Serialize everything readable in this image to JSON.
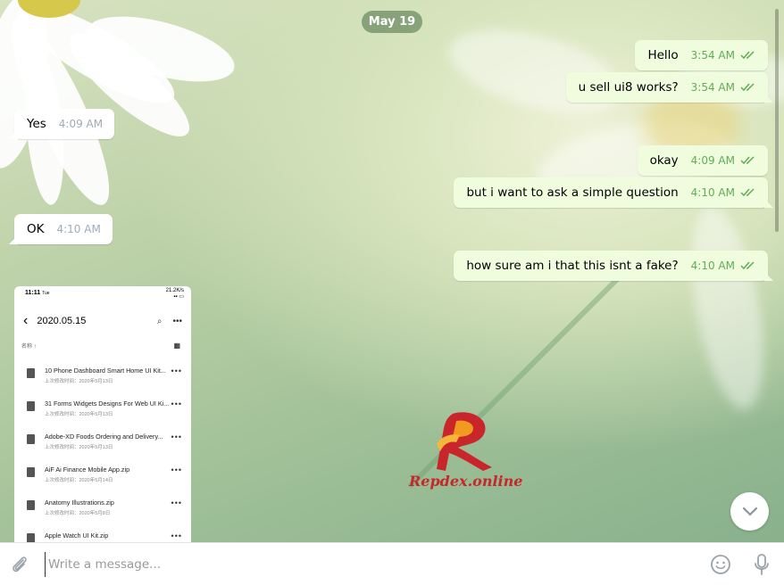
{
  "chat": {
    "date_label": "May 19",
    "messages": [
      {
        "dir": "out",
        "text": "Hello",
        "time": "3:54 AM"
      },
      {
        "dir": "out",
        "text": "u sell ui8 works?",
        "time": "3:54 AM"
      },
      {
        "dir": "in",
        "text": "Yes",
        "time": "4:09 AM"
      },
      {
        "dir": "out",
        "text": "okay",
        "time": "4:09 AM"
      },
      {
        "dir": "out",
        "text": "but i want to ask a simple question",
        "time": "4:10 AM"
      },
      {
        "dir": "in",
        "text": "OK",
        "time": "4:10 AM"
      },
      {
        "dir": "out",
        "text": "how sure am i that this isnt a fake?",
        "time": "4:10 AM"
      }
    ],
    "status_icon": "double-check-icon"
  },
  "screenshot": {
    "status_time": "11:11",
    "status_day": "Tue",
    "status_net": "21.2K/s",
    "title": "2020.05.15",
    "sort_label": "名称 ↑",
    "files": [
      {
        "name": "10 Phone Dashboard Smart Home UI Kit...",
        "meta": "上次修改时间：2020年5月13日"
      },
      {
        "name": "31 Forms Widgets Designs For Web UI Ki...",
        "meta": "上次修改时间：2020年5月13日"
      },
      {
        "name": "Adobe-XD Foods Ordering and Delivery...",
        "meta": "上次修改时间：2020年5月13日"
      },
      {
        "name": "AiF Ai Finance Mobile App.zip",
        "meta": "上次修改时间：2020年5月14日"
      },
      {
        "name": "Anatomy Illustrations.zip",
        "meta": "上次修改时间：2020年5月8日"
      },
      {
        "name": "Apple Watch UI Kit.zip",
        "meta": ""
      }
    ]
  },
  "watermark": {
    "text": "Repdex.online"
  },
  "composer": {
    "placeholder": "Write a message..."
  },
  "colors": {
    "out_bubble": "#effdde",
    "in_bubble": "#ffffff",
    "check": "#62ac55",
    "date_pill": "#6e8c64"
  }
}
